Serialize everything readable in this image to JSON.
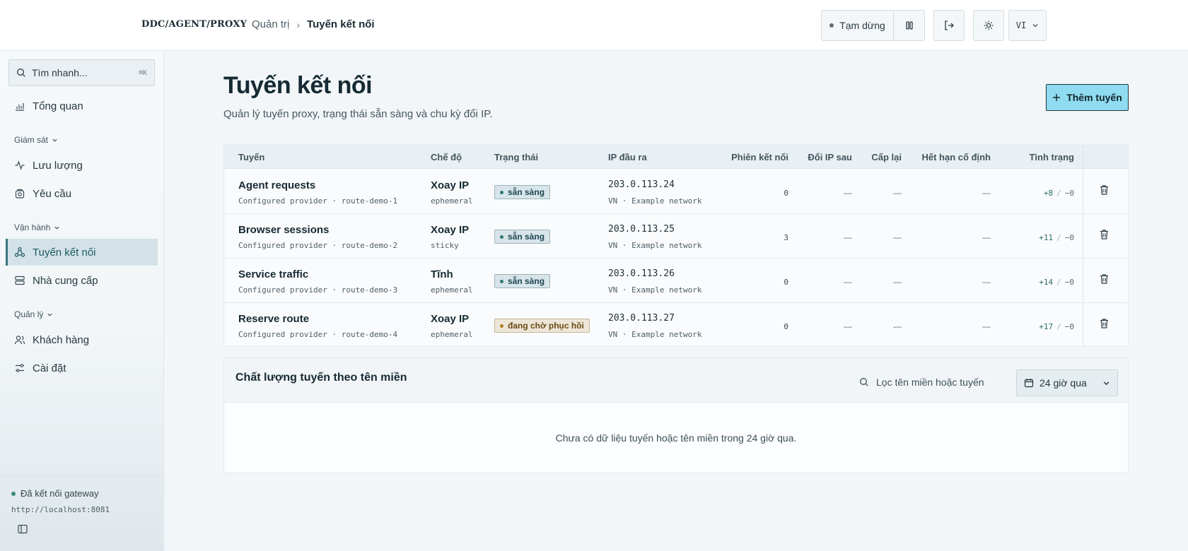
{
  "brand": "DDC/AGENT/PROXY",
  "breadcrumb": {
    "parent": "Quản trị",
    "separator": "›",
    "current": "Tuyến kết nối"
  },
  "toolbar": {
    "pause_label": "Tạm dừng",
    "language": "VI"
  },
  "sidebar": {
    "search": {
      "placeholder": "Tìm nhanh...",
      "shortcut": "⌘K"
    },
    "overview": "Tổng quan",
    "sections": [
      {
        "label": "Giám sát",
        "items": [
          "Lưu lượng",
          "Yêu cầu"
        ]
      },
      {
        "label": "Vận hành",
        "items": [
          "Tuyến kết nối",
          "Nhà cung cấp"
        ]
      },
      {
        "label": "Quản lý",
        "items": [
          "Khách hàng",
          "Cài đặt"
        ]
      }
    ],
    "active_item": "Tuyến kết nối",
    "gateway": {
      "status": "Đã kết nối gateway",
      "url": "http://localhost:8081"
    }
  },
  "page": {
    "title": "Tuyến kết nối",
    "subtitle": "Quản lý tuyến proxy, trạng thái sẵn sàng và chu kỳ đổi IP.",
    "add_button": "Thêm tuyến"
  },
  "table": {
    "columns": [
      "Tuyến",
      "Chế độ",
      "Trạng thái",
      "IP đầu ra",
      "Phiên kết nối",
      "Đổi IP sau",
      "Cấp lại",
      "Hết hạn cố định",
      "Tình trạng"
    ],
    "rows": [
      {
        "name": "Agent requests",
        "meta": "Configured provider · route-demo-1",
        "mode": "Xoay IP",
        "mode_meta": "ephemeral",
        "status": "sẵn sàng",
        "status_kind": "ok",
        "ip": "203.0.113.24",
        "ip_meta": "VN · Example network",
        "sessions": "0",
        "rotate_after": "—",
        "reissue": "—",
        "fixed_expiry": "—",
        "health_plus": "+8",
        "health_sep": "/",
        "health_minus": "−0"
      },
      {
        "name": "Browser sessions",
        "meta": "Configured provider · route-demo-2",
        "mode": "Xoay IP",
        "mode_meta": "sticky",
        "status": "sẵn sàng",
        "status_kind": "ok",
        "ip": "203.0.113.25",
        "ip_meta": "VN · Example network",
        "sessions": "3",
        "rotate_after": "—",
        "reissue": "—",
        "fixed_expiry": "—",
        "health_plus": "+11",
        "health_sep": "/",
        "health_minus": "−0"
      },
      {
        "name": "Service traffic",
        "meta": "Configured provider · route-demo-3",
        "mode": "Tĩnh",
        "mode_meta": "ephemeral",
        "status": "sẵn sàng",
        "status_kind": "ok",
        "ip": "203.0.113.26",
        "ip_meta": "VN · Example network",
        "sessions": "0",
        "rotate_after": "—",
        "reissue": "—",
        "fixed_expiry": "—",
        "health_plus": "+14",
        "health_sep": "/",
        "health_minus": "−0"
      },
      {
        "name": "Reserve route",
        "meta": "Configured provider · route-demo-4",
        "mode": "Xoay IP",
        "mode_meta": "ephemeral",
        "status": "đang chờ phục hồi",
        "status_kind": "wait",
        "ip": "203.0.113.27",
        "ip_meta": "VN · Example network",
        "sessions": "0",
        "rotate_after": "—",
        "reissue": "—",
        "fixed_expiry": "—",
        "health_plus": "+17",
        "health_sep": "/",
        "health_minus": "−0"
      }
    ]
  },
  "quality": {
    "title": "Chất lượng tuyến theo tên miền",
    "filter_placeholder": "Lọc tên miền hoặc tuyến",
    "range": "24 giờ qua",
    "empty": "Chưa có dữ liệu tuyến hoặc tên miền trong 24 giờ qua."
  },
  "colors": {
    "accent": "#8fdcf0",
    "active_nav": "#d3e2e8",
    "ok": "#2b7b6b",
    "wait": "#b07a1e"
  }
}
